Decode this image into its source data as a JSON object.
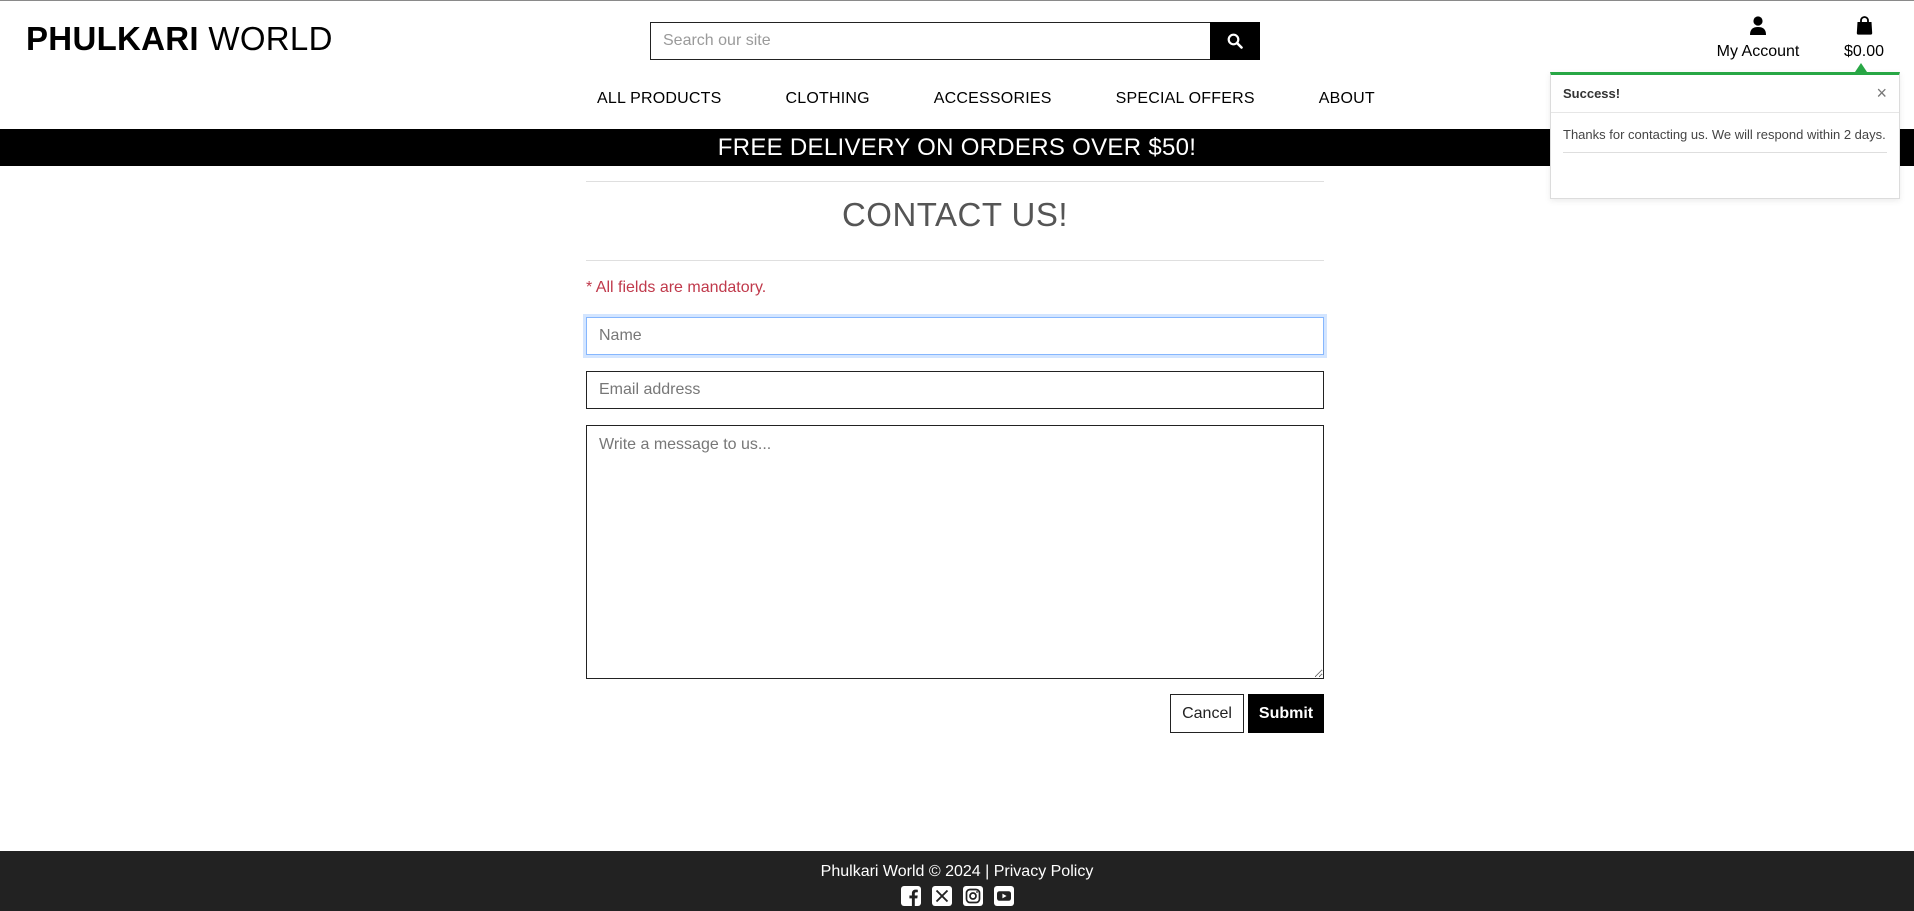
{
  "header": {
    "logo_bold": "PHULKARI",
    "logo_rest": " WORLD",
    "search_placeholder": "Search our site",
    "account_label": "My Account",
    "cart_total": "$0.00"
  },
  "nav": {
    "items": [
      "ALL PRODUCTS",
      "CLOTHING",
      "ACCESSORIES",
      "SPECIAL OFFERS",
      "ABOUT"
    ]
  },
  "banner": {
    "text": "FREE DELIVERY ON ORDERS OVER $50!"
  },
  "toast": {
    "title": "Success!",
    "close_glyph": "×",
    "message": "Thanks for contacting us. We will respond within 2 days.",
    "accent_color": "#28a745"
  },
  "contact": {
    "title": "CONTACT US!",
    "mandatory_note": "* All fields are mandatory.",
    "name_placeholder": "Name",
    "email_placeholder": "Email address",
    "message_placeholder": "Write a message to us...",
    "cancel_label": "Cancel",
    "submit_label": "Submit"
  },
  "footer": {
    "copyright": "Phulkari World © 2024 | ",
    "privacy_label": "Privacy Policy",
    "social_icons": [
      "facebook-icon",
      "x-twitter-icon",
      "instagram-icon",
      "youtube-icon"
    ]
  }
}
